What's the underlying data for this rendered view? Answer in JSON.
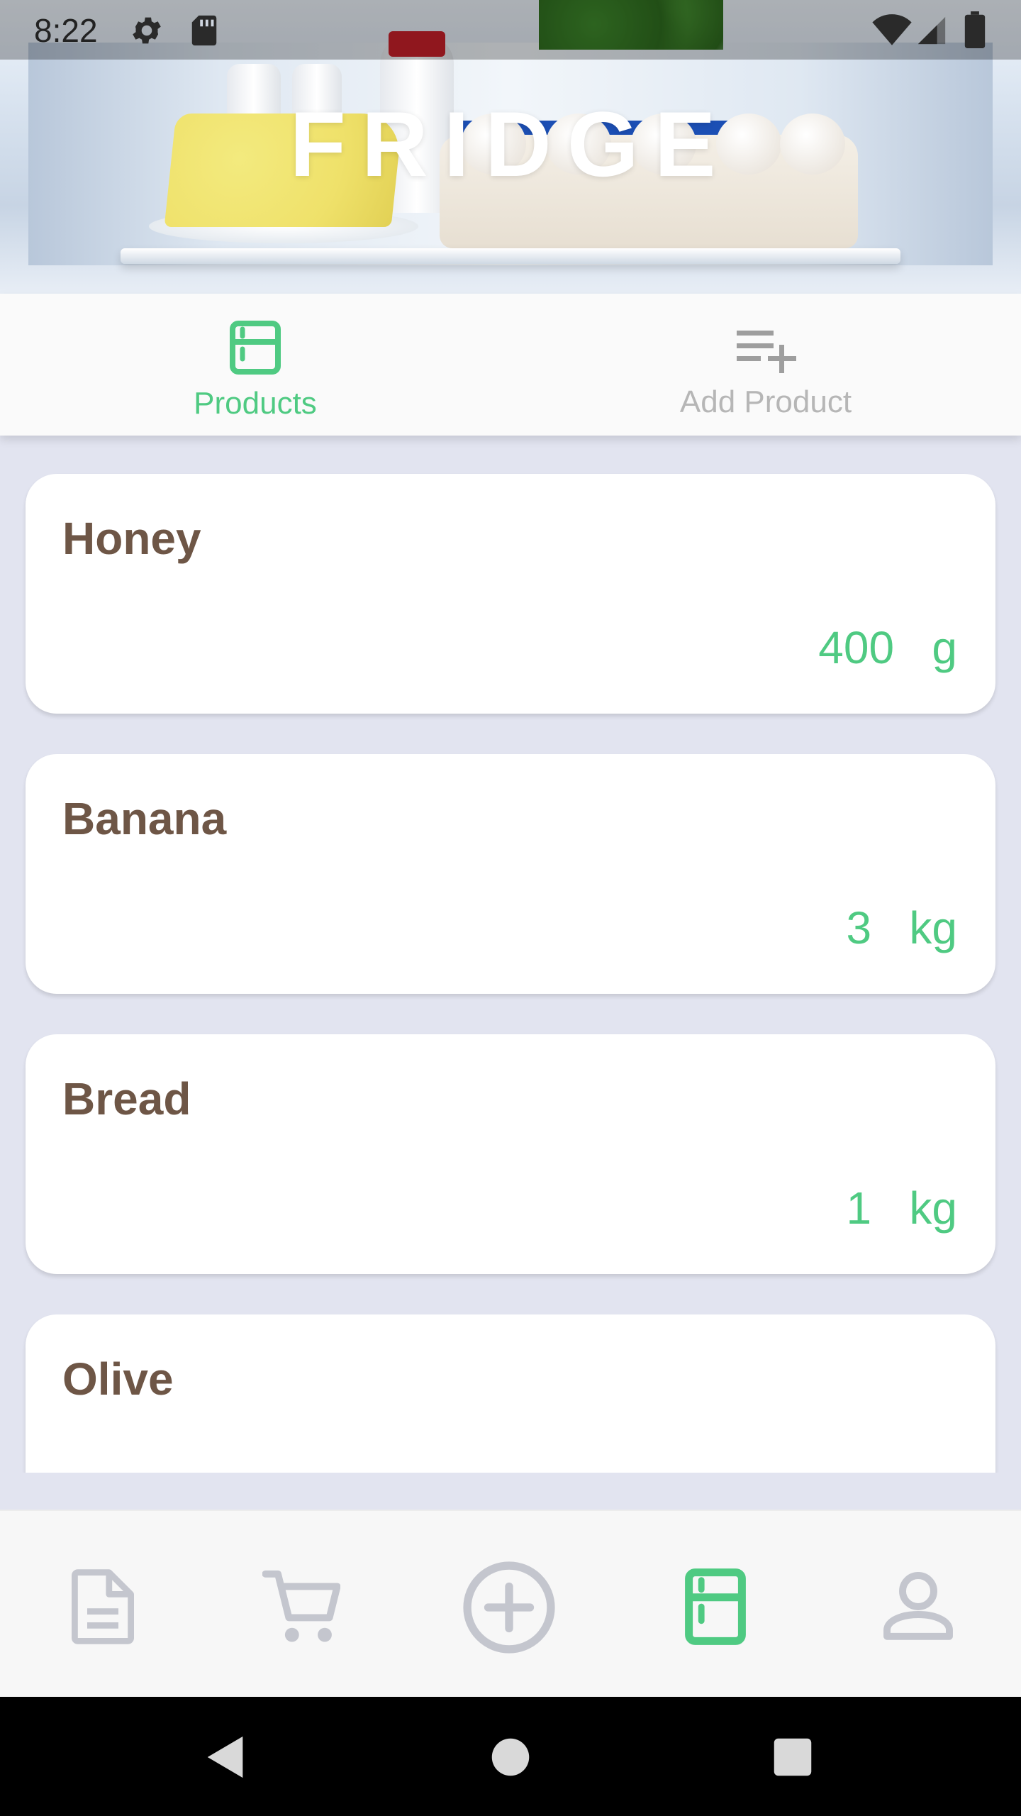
{
  "statusbar": {
    "time": "8:22"
  },
  "header": {
    "title": "FRIDGE"
  },
  "tabs": [
    {
      "label": "Products",
      "icon": "fridge-icon",
      "active": true
    },
    {
      "label": "Add Product",
      "icon": "playlist-add-icon",
      "active": false
    }
  ],
  "products": [
    {
      "name": "Honey",
      "amount": "400",
      "unit": "g"
    },
    {
      "name": "Banana",
      "amount": "3",
      "unit": "kg"
    },
    {
      "name": "Bread",
      "amount": "1",
      "unit": "kg"
    },
    {
      "name": "Olive",
      "amount": "",
      "unit": ""
    }
  ],
  "bottom_nav": [
    {
      "name": "document-icon",
      "active": false
    },
    {
      "name": "cart-icon",
      "active": false
    },
    {
      "name": "add-circle-icon",
      "active": false
    },
    {
      "name": "fridge-icon",
      "active": true
    },
    {
      "name": "user-icon",
      "active": false
    }
  ],
  "system_nav": [
    "back-icon",
    "home-icon",
    "recents-icon"
  ],
  "colors": {
    "accent": "#4fca82",
    "product_name": "#6e5646",
    "inactive": "#c4c6ce",
    "background": "#e2e4f0"
  }
}
